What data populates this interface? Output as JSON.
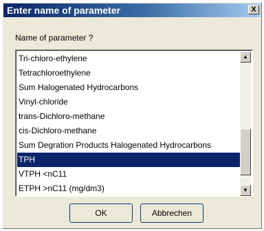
{
  "dialog": {
    "title": "Enter name of parameter",
    "close_label": "X",
    "prompt": "Name of parameter ?"
  },
  "list": {
    "items": [
      "Tri-chloro-ethylene",
      "Tetrachloroethylene",
      "Sum Halogenated Hydrocarbons",
      "Vinyl-chloride",
      "trans-Dichloro-methane",
      "cis-Dichloro-methane",
      "Sum Degration Products Halogenated Hydrocarbons",
      "TPH",
      "VTPH <nC11",
      "ETPH >nC11 (mg/dm3)"
    ],
    "selected": "TPH"
  },
  "buttons": {
    "ok": "OK",
    "cancel": "Abbrechen"
  },
  "scrollbar": {
    "up_glyph": "▲",
    "down_glyph": "▼"
  },
  "colors": {
    "title_bar": "#0a246a",
    "selection": "#0a246a",
    "dialog_bg": "#ece9d8"
  }
}
